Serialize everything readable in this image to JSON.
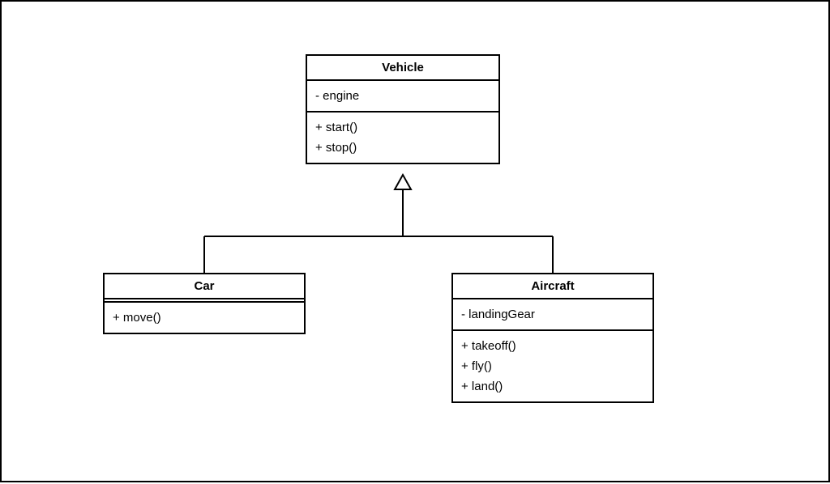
{
  "diagram": {
    "type": "uml-class",
    "classes": {
      "vehicle": {
        "name": "Vehicle",
        "attributes": [
          "- engine"
        ],
        "methods": [
          "+ start()",
          "+ stop()"
        ]
      },
      "car": {
        "name": "Car",
        "attributes": [],
        "methods": [
          "+ move()"
        ]
      },
      "aircraft": {
        "name": "Aircraft",
        "attributes": [
          "- landingGear"
        ],
        "methods": [
          "+ takeoff()",
          "+ fly()",
          "+ land()"
        ]
      }
    },
    "relationships": [
      {
        "type": "inheritance",
        "parent": "vehicle",
        "child": "car"
      },
      {
        "type": "inheritance",
        "parent": "vehicle",
        "child": "aircraft"
      }
    ]
  }
}
